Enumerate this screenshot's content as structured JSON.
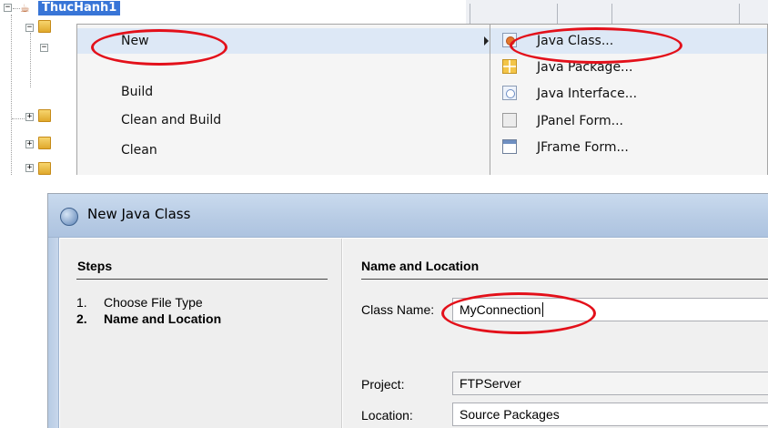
{
  "project_tree": {
    "project_name": "ThucHanh1"
  },
  "context_menu": {
    "items": [
      {
        "label": "New",
        "has_submenu": true,
        "highlighted": true
      },
      {
        "label": "Build"
      },
      {
        "label": "Clean and Build"
      },
      {
        "label": "Clean"
      }
    ]
  },
  "new_submenu": {
    "items": [
      {
        "label": "Java Class...",
        "icon": "java-class-icon",
        "highlighted": true
      },
      {
        "label": "Java Package...",
        "icon": "java-package-icon"
      },
      {
        "label": "Java Interface...",
        "icon": "java-interface-icon"
      },
      {
        "label": "JPanel Form...",
        "icon": "jpanel-form-icon"
      },
      {
        "label": "JFrame Form...",
        "icon": "jframe-form-icon"
      }
    ]
  },
  "dialog": {
    "title": "New Java Class",
    "steps_heading": "Steps",
    "steps": [
      {
        "number": "1.",
        "label": "Choose File Type",
        "current": false
      },
      {
        "number": "2.",
        "label": "Name and Location",
        "current": true
      }
    ],
    "section_heading": "Name and Location",
    "class_name_label": "Class Name:",
    "class_name_value": "MyConnection",
    "project_label": "Project:",
    "project_value": "FTPServer",
    "location_label": "Location:",
    "location_value": "Source Packages"
  },
  "annotation_color": "#e3101a",
  "highlight_color": "#3875d7"
}
